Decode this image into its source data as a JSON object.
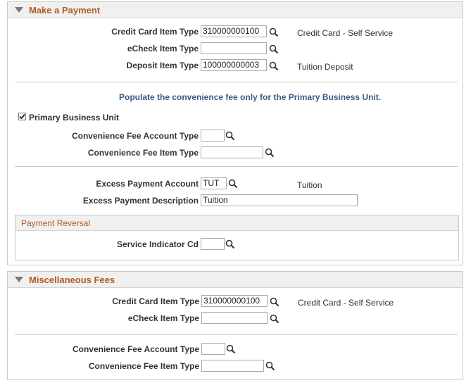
{
  "colors": {
    "section_title": "#b35a1f",
    "info_text": "#3a5b86",
    "header_bg": "#f0f0f0"
  },
  "make_payment": {
    "title": "Make a Payment",
    "credit_card_item_type": {
      "label": "Credit Card Item Type",
      "value": "310000000100",
      "description": "Credit Card - Self Service"
    },
    "echeck_item_type": {
      "label": "eCheck Item Type",
      "value": ""
    },
    "deposit_item_type": {
      "label": "Deposit Item Type",
      "value": "100000000003",
      "description": "Tuition Deposit"
    },
    "info_text": "Populate the convenience fee only for the Primary Business Unit.",
    "primary_business_unit": {
      "label": "Primary Business Unit",
      "checked": true
    },
    "conv_fee_account_type": {
      "label": "Convenience Fee Account Type",
      "value": ""
    },
    "conv_fee_item_type": {
      "label": "Convenience Fee Item Type",
      "value": ""
    },
    "excess_payment_account": {
      "label": "Excess Payment Account",
      "value": "TUT",
      "description": "Tuition"
    },
    "excess_payment_description": {
      "label": "Excess Payment Description",
      "value": "Tuition"
    },
    "payment_reversal": {
      "title": "Payment Reversal",
      "service_indicator_cd": {
        "label": "Service Indicator Cd",
        "value": ""
      }
    }
  },
  "misc_fees": {
    "title": "Miscellaneous Fees",
    "credit_card_item_type": {
      "label": "Credit Card Item Type",
      "value": "310000000100",
      "description": "Credit Card - Self Service"
    },
    "echeck_item_type": {
      "label": "eCheck Item Type",
      "value": ""
    },
    "conv_fee_account_type": {
      "label": "Convenience Fee Account Type",
      "value": ""
    },
    "conv_fee_item_type": {
      "label": "Convenience Fee Item Type",
      "value": ""
    }
  },
  "icons": {
    "lookup": "search-icon",
    "collapse": "collapse-triangle-icon"
  }
}
